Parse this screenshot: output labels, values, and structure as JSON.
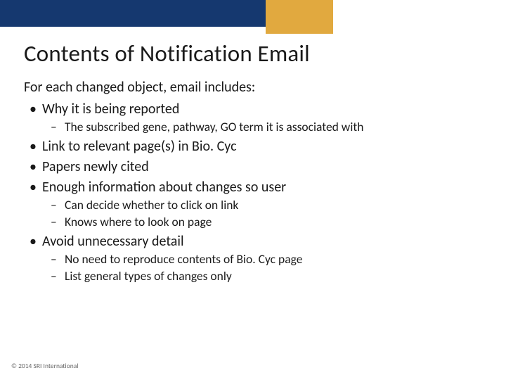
{
  "title": "Contents of Notification Email",
  "intro": "For each changed object, email includes:",
  "bullets": {
    "b0": "Why it is being reported",
    "b0s0": "The subscribed gene, pathway, GO term it is associated with",
    "b1": "Link to relevant page(s) in Bio. Cyc",
    "b2": "Papers newly cited",
    "b3": "Enough information about changes so user",
    "b3s0": "Can decide whether to click on link",
    "b3s1": "Knows where to look on page",
    "b4": "Avoid unnecessary detail",
    "b4s0": "No need to reproduce contents of Bio. Cyc page",
    "b4s1": "List general types of changes only"
  },
  "footer": "© 2014 SRI International"
}
